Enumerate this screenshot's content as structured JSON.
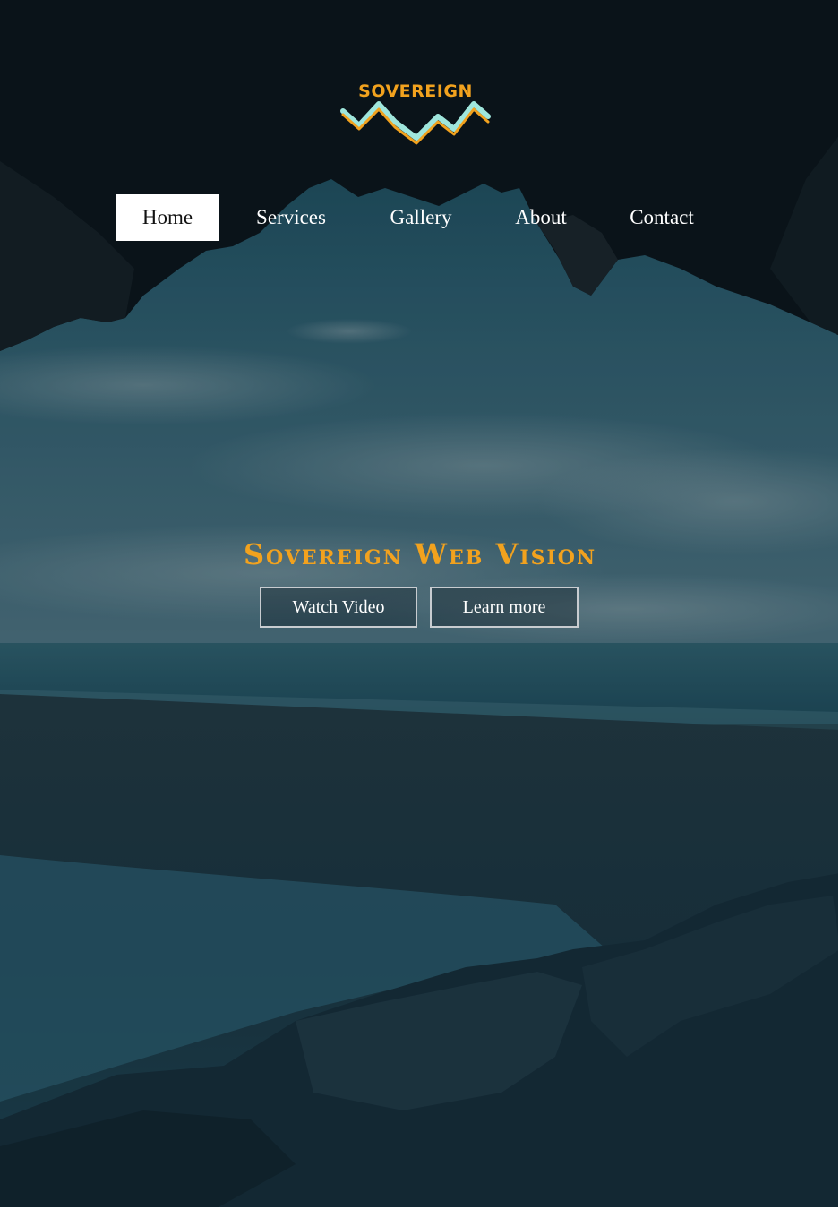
{
  "brand": {
    "name": "SOVEREIGN",
    "primary_color": "#f2a21e",
    "wave_colors": [
      "#f2a21e",
      "#9fe6dc"
    ]
  },
  "nav": {
    "items": [
      {
        "label": "Home",
        "active": true
      },
      {
        "label": "Services",
        "active": false
      },
      {
        "label": "Gallery",
        "active": false
      },
      {
        "label": "About",
        "active": false
      },
      {
        "label": "Contact",
        "active": false
      }
    ]
  },
  "hero": {
    "title": "Sovereign Web Vision",
    "title_color": "#f2a21e",
    "buttons": {
      "watch_video": "Watch Video",
      "learn_more": "Learn more"
    },
    "background": "cave-mouth-beach-photo"
  }
}
